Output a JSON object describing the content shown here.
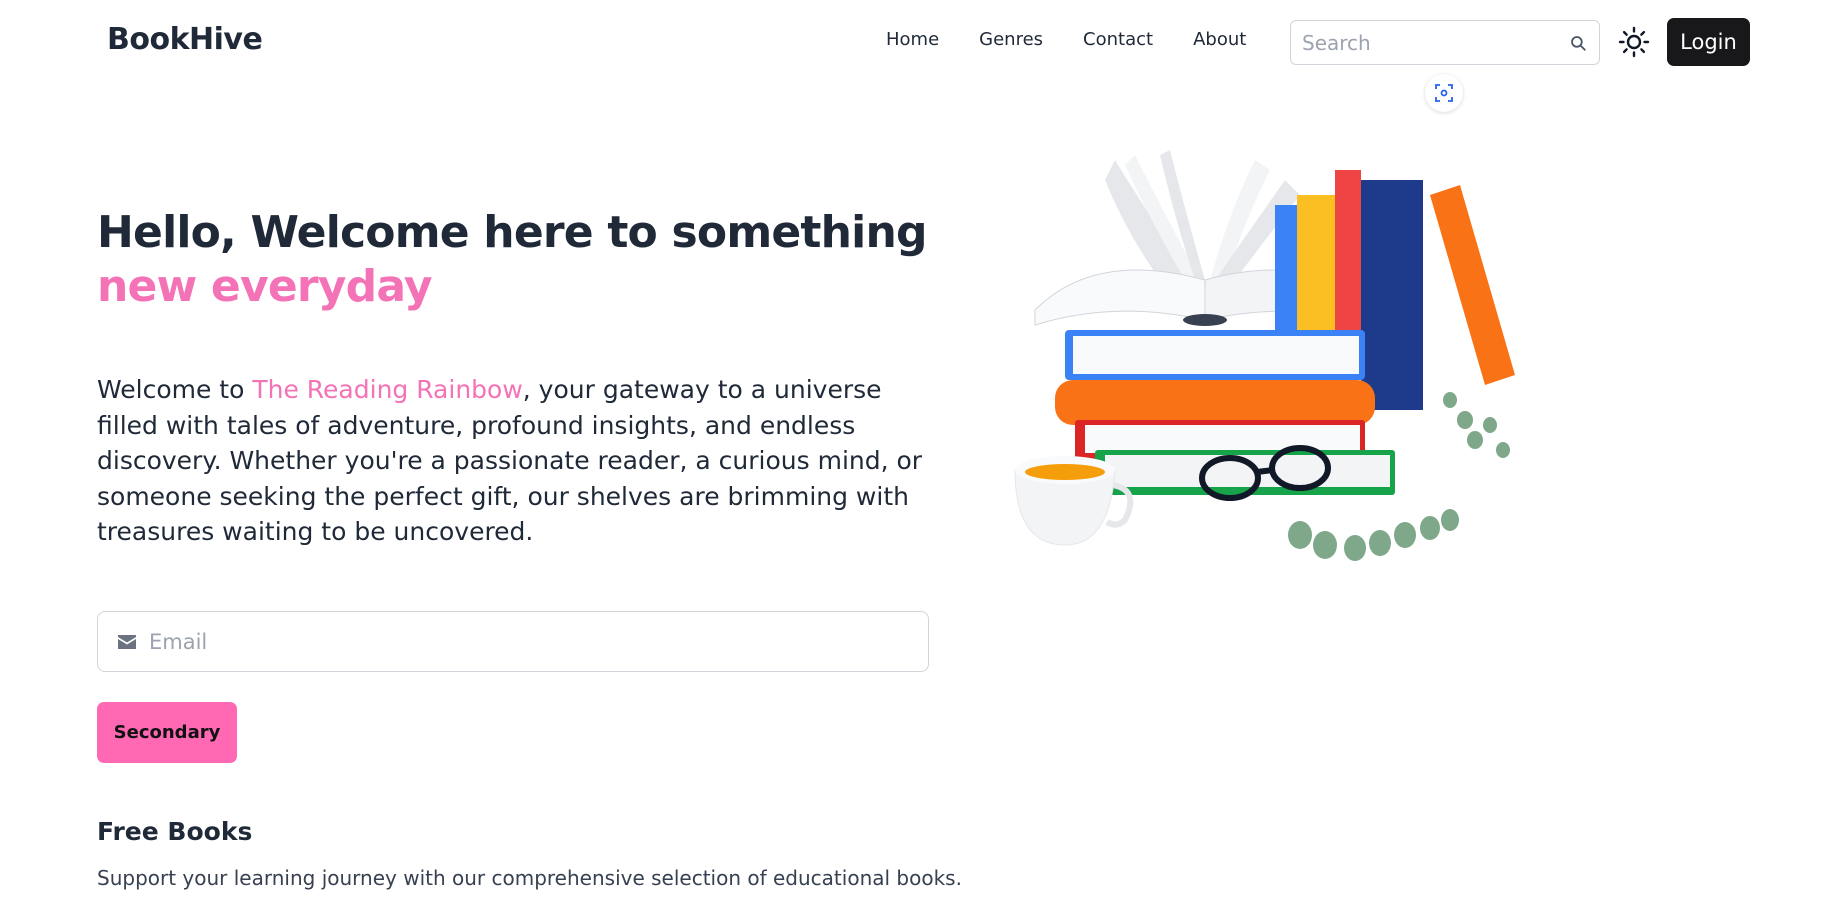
{
  "navbar": {
    "brand": "BookHive",
    "links": [
      "Home",
      "Genres",
      "Contact",
      "About"
    ],
    "search": {
      "placeholder": "Search"
    },
    "login_label": "Login"
  },
  "hero": {
    "title_line1": "Hello, Welcome here to something",
    "title_accent": "new everyday",
    "desc_prefix": "Welcome to ",
    "desc_highlight": "The Reading Rainbow",
    "desc_suffix": ", your gateway to a universe filled with tales of adventure, profound insights, and endless discovery. Whether you're a passionate reader, a curious mind, or someone seeking the perfect gift, our shelves are brimming with treasures waiting to be uncovered.",
    "email": {
      "placeholder": "Email"
    },
    "button_label": "Secondary"
  },
  "section": {
    "title": "Free Books",
    "description": "Support your learning journey with our comprehensive selection of educational books."
  },
  "colors": {
    "accent": "#f472b6",
    "button_pink": "#ff69b4",
    "login_bg": "#18181b"
  },
  "icons": [
    "search-icon",
    "sun-icon",
    "scan-icon",
    "envelope-icon"
  ]
}
